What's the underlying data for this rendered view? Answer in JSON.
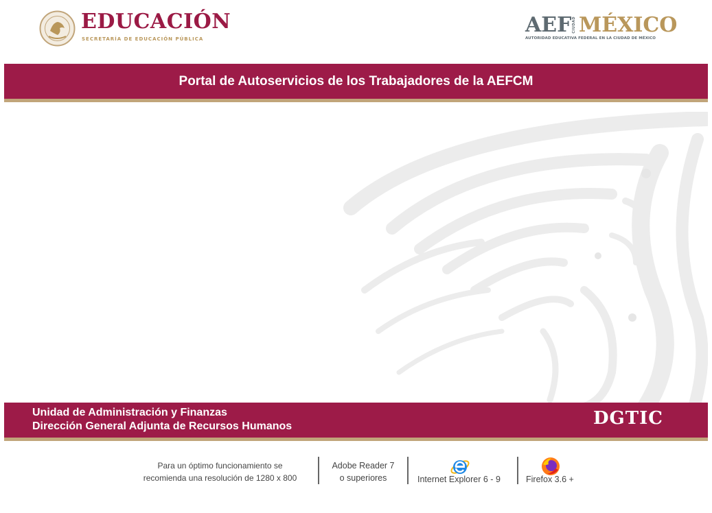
{
  "header": {
    "edu_title": "EDUCACIÓN",
    "edu_subtitle": "SECRETARÍA DE EDUCACIÓN PÚBLICA",
    "aef_part": "AEF",
    "aef_ciudad": "CIUDAD",
    "aef_mexico": "MÉXICO",
    "aef_subtitle": "AUTORIDAD EDUCATIVA FEDERAL EN LA CIUDAD DE MÉXICO"
  },
  "title_bar": {
    "title": "Portal de Autoservicios de los Trabajadores de la AEFCM"
  },
  "footer": {
    "line1": "Unidad de Administración y Finanzas",
    "line2": "Dirección General Adjunta de Recursos Humanos",
    "dgtic": "DGTIC"
  },
  "requirements": {
    "resolution_line1": "Para un óptimo funcionamiento se",
    "resolution_line2": "recomienda una resolución de 1280 x 800",
    "adobe_line1": "Adobe Reader  7",
    "adobe_line2": "o superiores",
    "ie_label": "Internet Explorer 6 - 9",
    "firefox_label": "Firefox 3.6 +"
  },
  "colors": {
    "brand_maroon": "#9d1b48",
    "brand_gold": "#c1a57a",
    "gray": "#5e6a71"
  },
  "icons": [
    "national-seal-icon",
    "eagle-watermark-icon",
    "internet-explorer-icon",
    "firefox-icon"
  ]
}
